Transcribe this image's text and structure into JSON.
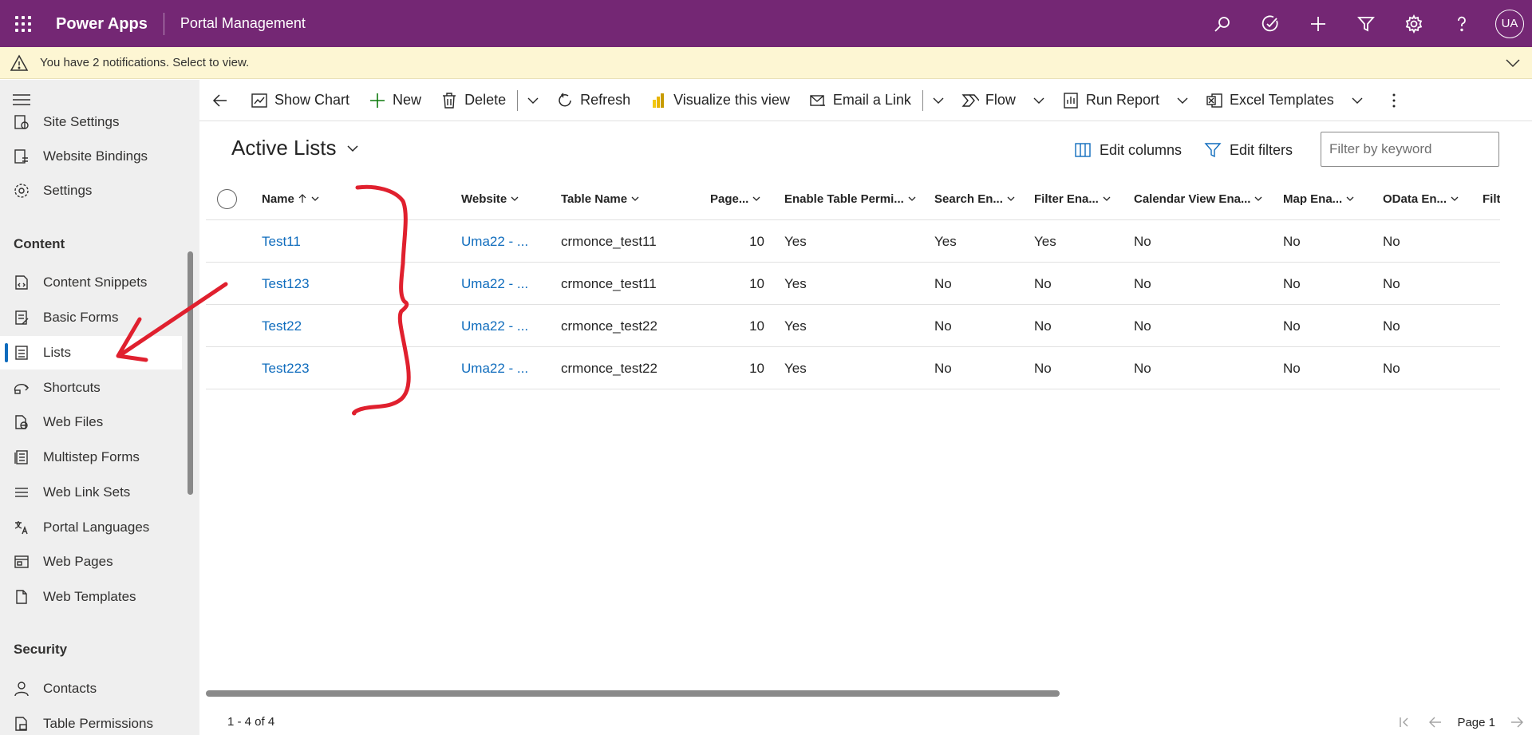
{
  "topbar": {
    "app_name": "Power Apps",
    "environment": "Portal Management",
    "avatar_initials": "UA",
    "color": "#742774"
  },
  "notification": {
    "text": "You have 2 notifications. Select to view."
  },
  "sidebar": {
    "items_top": [
      {
        "label": "Site Settings",
        "icon": "site-settings-icon"
      },
      {
        "label": "Website Bindings",
        "icon": "website-bindings-icon"
      },
      {
        "label": "Settings",
        "icon": "gear-icon"
      }
    ],
    "section_content": "Content",
    "items_content": [
      {
        "label": "Content Snippets",
        "icon": "snippet-icon"
      },
      {
        "label": "Basic Forms",
        "icon": "form-icon"
      },
      {
        "label": "Lists",
        "icon": "list-icon",
        "selected": true
      },
      {
        "label": "Shortcuts",
        "icon": "shortcut-icon"
      },
      {
        "label": "Web Files",
        "icon": "web-file-icon"
      },
      {
        "label": "Multistep Forms",
        "icon": "multistep-form-icon"
      },
      {
        "label": "Web Link Sets",
        "icon": "link-set-icon"
      },
      {
        "label": "Portal Languages",
        "icon": "language-icon"
      },
      {
        "label": "Web Pages",
        "icon": "web-page-icon"
      },
      {
        "label": "Web Templates",
        "icon": "template-icon"
      }
    ],
    "section_security": "Security",
    "items_security": [
      {
        "label": "Contacts",
        "icon": "person-icon"
      },
      {
        "label": "Table Permissions",
        "icon": "permission-icon"
      }
    ]
  },
  "commandbar": {
    "show_chart": "Show Chart",
    "new": "New",
    "delete": "Delete",
    "refresh": "Refresh",
    "visualize": "Visualize this view",
    "email_link": "Email a Link",
    "flow": "Flow",
    "run_report": "Run Report",
    "excel_templates": "Excel Templates"
  },
  "view": {
    "title": "Active Lists",
    "edit_columns": "Edit columns",
    "edit_filters": "Edit filters",
    "filter_placeholder": "Filter by keyword"
  },
  "grid": {
    "columns": [
      "Name",
      "Website",
      "Table Name",
      "Page...",
      "Enable Table Permi...",
      "Search En...",
      "Filter Ena...",
      "Calendar View Ena...",
      "Map Ena...",
      "OData En...",
      "Filt"
    ],
    "rows": [
      {
        "name": "Test11",
        "website": "Uma22 - ...",
        "table": "crmonce_test11",
        "page": "10",
        "perm": "Yes",
        "search": "Yes",
        "filter": "Yes",
        "calendar": "No",
        "map": "No",
        "odata": "No"
      },
      {
        "name": "Test123",
        "website": "Uma22 - ...",
        "table": "crmonce_test11",
        "page": "10",
        "perm": "Yes",
        "search": "No",
        "filter": "No",
        "calendar": "No",
        "map": "No",
        "odata": "No"
      },
      {
        "name": "Test22",
        "website": "Uma22 - ...",
        "table": "crmonce_test22",
        "page": "10",
        "perm": "Yes",
        "search": "No",
        "filter": "No",
        "calendar": "No",
        "map": "No",
        "odata": "No"
      },
      {
        "name": "Test223",
        "website": "Uma22 - ...",
        "table": "crmonce_test22",
        "page": "10",
        "perm": "Yes",
        "search": "No",
        "filter": "No",
        "calendar": "No",
        "map": "No",
        "odata": "No"
      }
    ]
  },
  "footer": {
    "count": "1 - 4 of 4",
    "page": "Page 1"
  },
  "annotation_color": "#e0202e"
}
